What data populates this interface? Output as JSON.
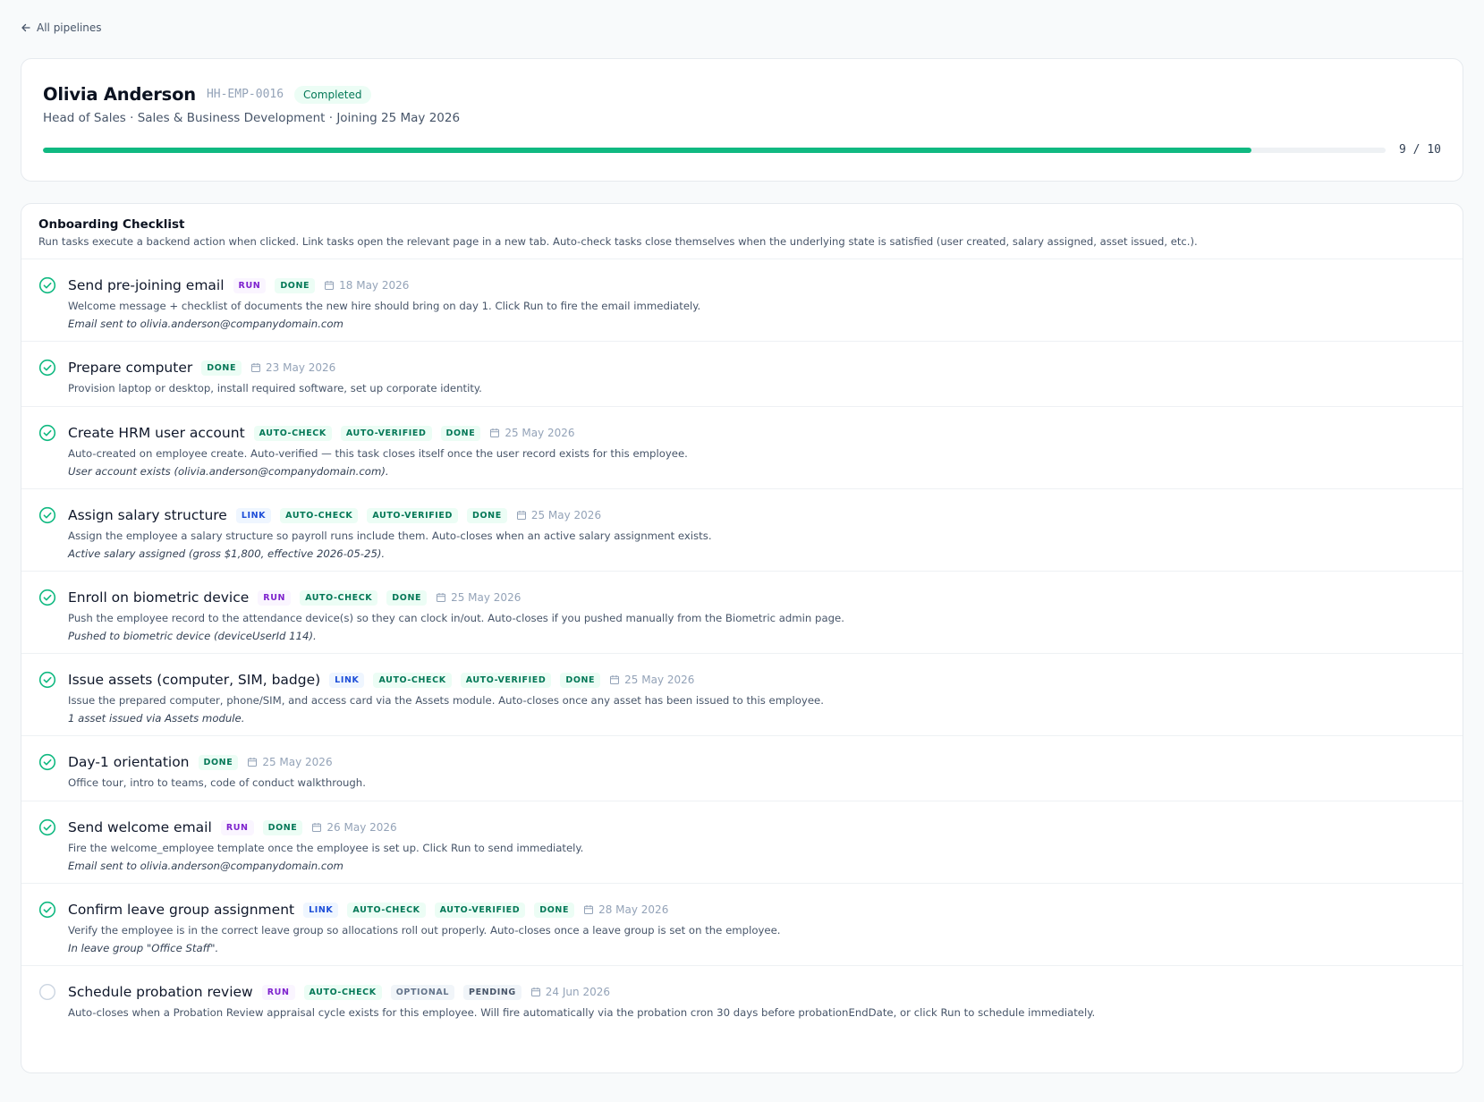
{
  "nav": {
    "back_label": "All pipelines"
  },
  "employee": {
    "name": "Olivia Anderson",
    "id": "HH-EMP-0016",
    "status": "Completed",
    "subtitle": "Head of Sales · Sales & Business Development · Joining 25 May 2026",
    "progress_done": 9,
    "progress_total": 10,
    "progress_label": "9 / 10"
  },
  "colors": {
    "accent": "#10b981",
    "run": "#7e22ce",
    "link": "#1d4ed8",
    "auto": "#047857"
  },
  "checklist": {
    "title": "Onboarding Checklist",
    "description": "Run tasks execute a backend action when clicked. Link tasks open the relevant page in a new tab. Auto-check tasks close themselves when the underlying state is satisfied (user created, salary assigned, asset issued, etc.).",
    "tasks": [
      {
        "title": "Send pre-joining email",
        "done": true,
        "tags": [
          {
            "label": "RUN",
            "kind": "run"
          },
          {
            "label": "DONE",
            "kind": "done"
          }
        ],
        "date": "18 May 2026",
        "description": "Welcome message + checklist of documents the new hire should bring on day 1. Click Run to fire the email immediately.",
        "note": "Email sent to olivia.anderson@companydomain.com"
      },
      {
        "title": "Prepare computer",
        "done": true,
        "tags": [
          {
            "label": "DONE",
            "kind": "done"
          }
        ],
        "date": "23 May 2026",
        "description": "Provision laptop or desktop, install required software, set up corporate identity.",
        "note": ""
      },
      {
        "title": "Create HRM user account",
        "done": true,
        "tags": [
          {
            "label": "AUTO-CHECK",
            "kind": "auto"
          },
          {
            "label": "AUTO-VERIFIED",
            "kind": "auto"
          },
          {
            "label": "DONE",
            "kind": "done"
          }
        ],
        "date": "25 May 2026",
        "description": "Auto-created on employee create. Auto-verified — this task closes itself once the user record exists for this employee.",
        "note": "User account exists (olivia.anderson@companydomain.com)."
      },
      {
        "title": "Assign salary structure",
        "done": true,
        "tags": [
          {
            "label": "LINK",
            "kind": "link"
          },
          {
            "label": "AUTO-CHECK",
            "kind": "auto"
          },
          {
            "label": "AUTO-VERIFIED",
            "kind": "auto"
          },
          {
            "label": "DONE",
            "kind": "done"
          }
        ],
        "date": "25 May 2026",
        "description": "Assign the employee a salary structure so payroll runs include them. Auto-closes when an active salary assignment exists.",
        "note": "Active salary assigned (gross $1,800, effective 2026-05-25)."
      },
      {
        "title": "Enroll on biometric device",
        "done": true,
        "tags": [
          {
            "label": "RUN",
            "kind": "run"
          },
          {
            "label": "AUTO-CHECK",
            "kind": "auto"
          },
          {
            "label": "DONE",
            "kind": "done"
          }
        ],
        "date": "25 May 2026",
        "description": "Push the employee record to the attendance device(s) so they can clock in/out. Auto-closes if you pushed manually from the Biometric admin page.",
        "note": "Pushed to biometric device (deviceUserId 114)."
      },
      {
        "title": "Issue assets (computer, SIM, badge)",
        "done": true,
        "tags": [
          {
            "label": "LINK",
            "kind": "link"
          },
          {
            "label": "AUTO-CHECK",
            "kind": "auto"
          },
          {
            "label": "AUTO-VERIFIED",
            "kind": "auto"
          },
          {
            "label": "DONE",
            "kind": "done"
          }
        ],
        "date": "25 May 2026",
        "description": "Issue the prepared computer, phone/SIM, and access card via the Assets module. Auto-closes once any asset has been issued to this employee.",
        "note": "1 asset issued via Assets module."
      },
      {
        "title": "Day-1 orientation",
        "done": true,
        "tags": [
          {
            "label": "DONE",
            "kind": "done"
          }
        ],
        "date": "25 May 2026",
        "description": "Office tour, intro to teams, code of conduct walkthrough.",
        "note": ""
      },
      {
        "title": "Send welcome email",
        "done": true,
        "tags": [
          {
            "label": "RUN",
            "kind": "run"
          },
          {
            "label": "DONE",
            "kind": "done"
          }
        ],
        "date": "26 May 2026",
        "description": "Fire the welcome_employee template once the employee is set up. Click Run to send immediately.",
        "note": "Email sent to olivia.anderson@companydomain.com"
      },
      {
        "title": "Confirm leave group assignment",
        "done": true,
        "tags": [
          {
            "label": "LINK",
            "kind": "link"
          },
          {
            "label": "AUTO-CHECK",
            "kind": "auto"
          },
          {
            "label": "AUTO-VERIFIED",
            "kind": "auto"
          },
          {
            "label": "DONE",
            "kind": "done"
          }
        ],
        "date": "28 May 2026",
        "description": "Verify the employee is in the correct leave group so allocations roll out properly. Auto-closes once a leave group is set on the employee.",
        "note": "In leave group \"Office Staff\"."
      },
      {
        "title": "Schedule probation review",
        "done": false,
        "tags": [
          {
            "label": "RUN",
            "kind": "run"
          },
          {
            "label": "AUTO-CHECK",
            "kind": "auto"
          },
          {
            "label": "OPTIONAL",
            "kind": "optional"
          },
          {
            "label": "PENDING",
            "kind": "pending"
          }
        ],
        "date": "24 Jun 2026",
        "description": "Auto-closes when a Probation Review appraisal cycle exists for this employee. Will fire automatically via the probation cron 30 days before probationEndDate, or click Run to schedule immediately.",
        "note": ""
      }
    ]
  }
}
